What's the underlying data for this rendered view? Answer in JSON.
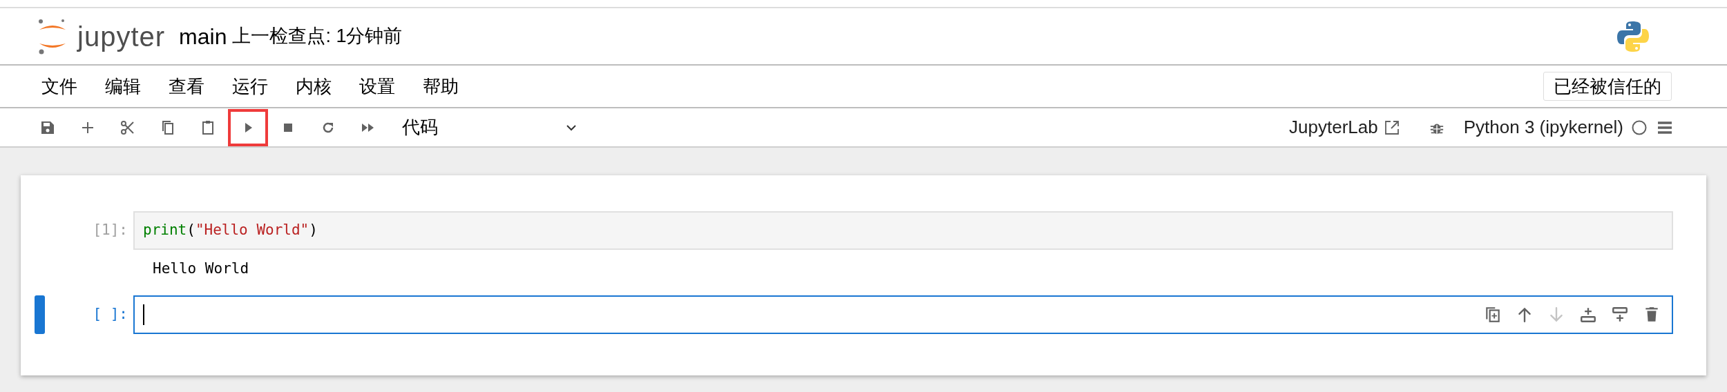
{
  "header": {
    "logo_text": "jupyter",
    "notebook_name": "main",
    "checkpoint": "上一检查点: 1分钟前"
  },
  "menu": [
    {
      "label": "文件"
    },
    {
      "label": "编辑"
    },
    {
      "label": "查看"
    },
    {
      "label": "运行"
    },
    {
      "label": "内核"
    },
    {
      "label": "设置"
    },
    {
      "label": "帮助"
    }
  ],
  "trusted_button": "已经被信任的",
  "toolbar": {
    "buttons": [
      {
        "kind": "save",
        "highlighted": false
      },
      {
        "kind": "add",
        "highlighted": false
      },
      {
        "kind": "cut",
        "highlighted": false
      },
      {
        "kind": "copy",
        "highlighted": false
      },
      {
        "kind": "paste",
        "highlighted": false
      },
      {
        "kind": "run",
        "highlighted": true
      },
      {
        "kind": "stop",
        "highlighted": false
      },
      {
        "kind": "restart",
        "highlighted": false
      },
      {
        "kind": "run-all",
        "highlighted": false
      }
    ],
    "cell_type": "代码",
    "jupyterlab_link": "JupyterLab",
    "kernel": "Python 3 (ipykernel)",
    "kernel_busy": false
  },
  "cells": [
    {
      "prompt": "[1]:",
      "active": false,
      "code": [
        {
          "kind": "builtin",
          "text": "print"
        },
        {
          "kind": "plain",
          "text": "("
        },
        {
          "kind": "string",
          "text": "\"Hello World\""
        },
        {
          "kind": "plain",
          "text": ")"
        }
      ],
      "output": "Hello World"
    },
    {
      "prompt": "[ ]:",
      "active": true,
      "tools": [
        {
          "kind": "duplicate",
          "disabled": false
        },
        {
          "kind": "move-up",
          "disabled": false
        },
        {
          "kind": "move-down",
          "disabled": true
        },
        {
          "kind": "insert-above",
          "disabled": false
        },
        {
          "kind": "insert-below",
          "disabled": false
        },
        {
          "kind": "delete",
          "disabled": false
        }
      ]
    }
  ]
}
